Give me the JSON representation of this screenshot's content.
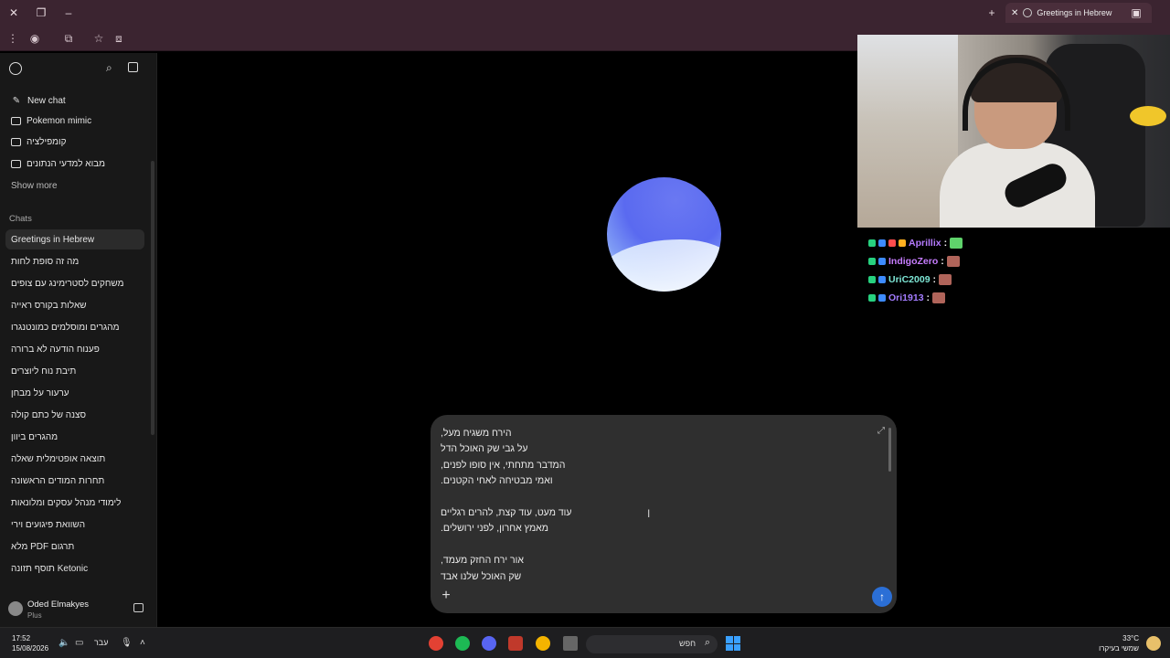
{
  "browser": {
    "active_tab_title": "Greetings in Hebrew"
  },
  "sidebar": {
    "new_chat": "New chat",
    "projects": [
      "Pokemon mimic",
      "קומפילציה",
      "מבוא למדעי הנתונים"
    ],
    "show_more": "Show more",
    "chats_label": "Chats",
    "chats": [
      "Greetings in Hebrew",
      "מה זה סופת לחות",
      "משחקים לסטרימינג עם צופים",
      "שאלות בקורס ראייה",
      "מהגרים ומוסלמים כמונטנגרו",
      "פענוח הודעה לא ברורה",
      "תיבת נוח ליוצרים",
      "ערעור על מבחן",
      "סצנה של כתם קולה",
      "מהגרים ביוון",
      "תוצאה אופטימלית שאלה",
      "תחרות המודים הראשונה",
      "לימודי מנהל עסקים ומלונאות",
      "השוואת פיגועים וירי",
      "תרגום PDF מלא",
      "Ketonic תוסף תזונה"
    ],
    "user": {
      "name": "Oded Elmakyes",
      "plan": "Plus"
    }
  },
  "composer": {
    "lines": [
      "הירח משגיח מעל,",
      "על גבי שק האוכל הדל",
      "המדבר מתחתי, אין סופו לפנים,",
      "ואמי מבטיחה לאחי הקטנים.",
      "",
      "עוד מעט, עוד קצת, להרים רגליים",
      "מאמץ אחרון, לפני ירושלים.",
      "",
      "אור ירח החזק מעמד,",
      "שק האוכל שלנו אבד"
    ]
  },
  "stream_chat": [
    {
      "user": "Aprillix",
      "color": "#b57bff"
    },
    {
      "user": "IndigoZero",
      "color": "#c77dff"
    },
    {
      "user": "UriC2009",
      "color": "#7ee7d6"
    },
    {
      "user": "Ori1913",
      "color": "#a37cff"
    }
  ],
  "taskbar": {
    "time": "17:52",
    "date": "15/08/2026",
    "language": "עבר",
    "search_label": "חפש",
    "temperature": "33°C",
    "weather": "שמשי בעיקרו"
  }
}
